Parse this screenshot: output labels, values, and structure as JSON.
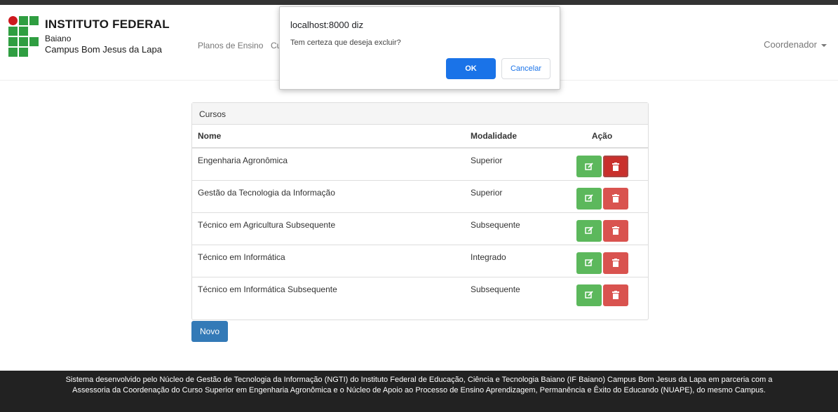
{
  "header": {
    "logo_title": "INSTITUTO FEDERAL",
    "logo_sub1": "Baiano",
    "logo_sub2": "Campus Bom Jesus da Lapa",
    "nav_link": "Planos de Ensino",
    "nav_link2": "Cu",
    "user_menu": "Coordenador"
  },
  "panel": {
    "heading": "Cursos",
    "columns": [
      "Nome",
      "Modalidade",
      "Ação"
    ],
    "rows": [
      {
        "nome": "Engenharia Agronômica",
        "modalidade": "Superior"
      },
      {
        "nome": "Gestão da Tecnologia da Informação",
        "modalidade": "Superior"
      },
      {
        "nome": "Técnico em Agricultura Subsequente",
        "modalidade": "Subsequente"
      },
      {
        "nome": "Técnico em Informática",
        "modalidade": "Integrado"
      },
      {
        "nome": "Técnico em Informática Subsequente",
        "modalidade": "Subsequente"
      }
    ]
  },
  "novo_label": "Novo",
  "footer_text": "Sistema desenvolvido pelo Núcleo de Gestão de Tecnologia da Informação (NGTI) do Instituto Federal de Educação, Ciência e Tecnologia Baiano (IF Baiano) Campus Bom Jesus da Lapa em parceria com a Assessoria da Coordenação do Curso Superior em Engenharia Agronômica e o Núcleo de Apoio ao Processo de Ensino Aprendizagem, Permanência e Êxito do Educando (NUAPE), do mesmo Campus.",
  "dialog": {
    "title": "localhost:8000 diz",
    "message": "Tem certeza que deseja excluir?",
    "ok_label": "OK",
    "cancel_label": "Cancelar"
  },
  "colors": {
    "brand_green": "#2f9e41",
    "brand_red": "#cd191e",
    "edit": "#5cb85c",
    "delete": "#d9534f",
    "primary": "#337ab7"
  },
  "icons": {
    "edit": "edit-icon",
    "delete": "trash-icon"
  }
}
